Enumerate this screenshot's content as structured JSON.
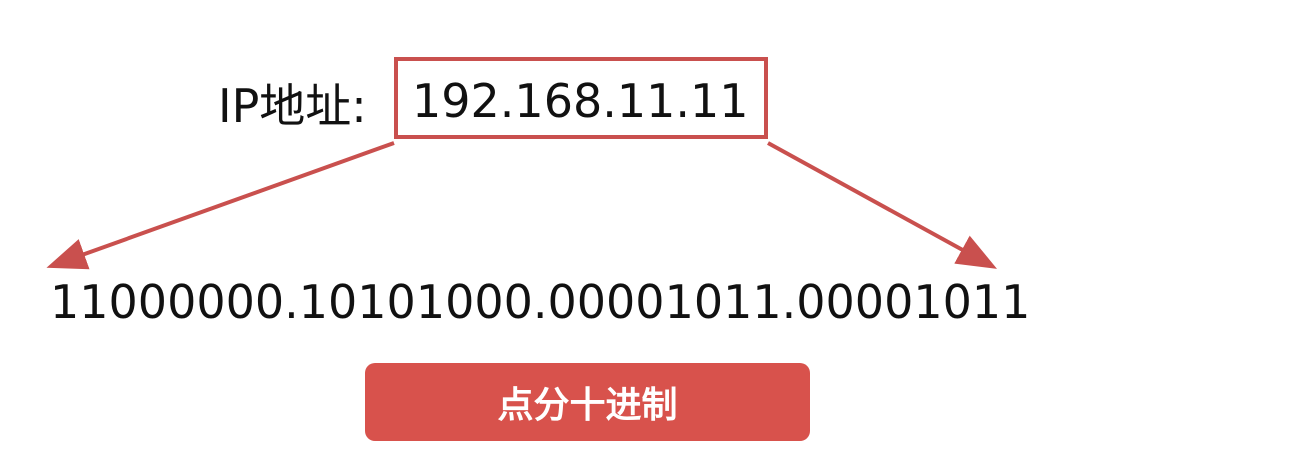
{
  "ip": {
    "label": "IP地址:",
    "value": "192.168.11.11"
  },
  "binary": "11000000.10101000.00001011.00001011",
  "caption": "点分十进制",
  "colors": {
    "accent": "#d8524c",
    "box_border": "#c9504e",
    "arrow": "#c9504e",
    "text": "#111111"
  }
}
